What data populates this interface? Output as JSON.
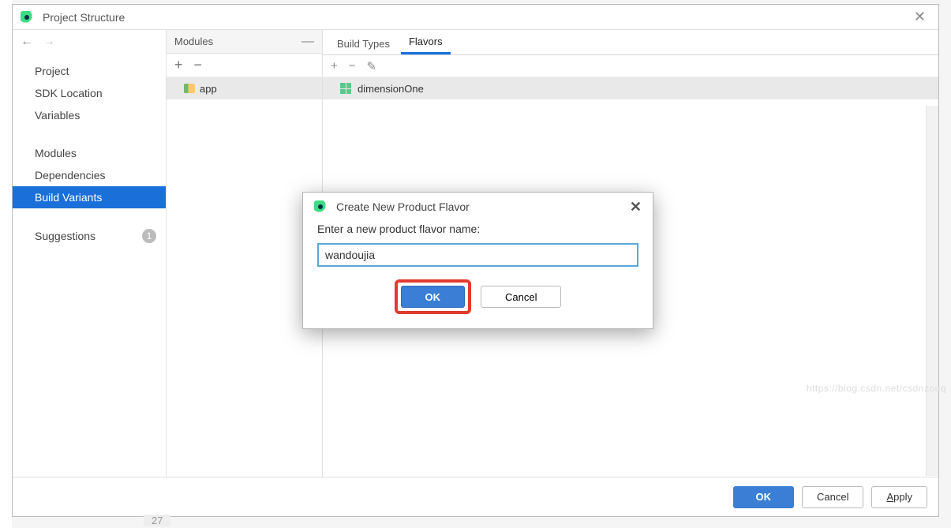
{
  "window": {
    "title": "Project Structure"
  },
  "nav": {
    "back_icon": "←",
    "forward_icon": "→",
    "items": [
      {
        "label": "Project"
      },
      {
        "label": "SDK Location"
      },
      {
        "label": "Variables"
      },
      {
        "label": "Modules"
      },
      {
        "label": "Dependencies"
      },
      {
        "label": "Build Variants",
        "selected": true
      },
      {
        "label": "Suggestions",
        "badge": "1"
      }
    ]
  },
  "modules": {
    "header": "Modules",
    "collapse_icon": "—",
    "add_icon": "+",
    "remove_icon": "−",
    "items": [
      {
        "label": "app"
      }
    ]
  },
  "tabs": {
    "items": [
      {
        "label": "Build Types"
      },
      {
        "label": "Flavors",
        "selected": true
      }
    ]
  },
  "flavors_toolbar": {
    "add_icon": "+",
    "remove_icon": "−",
    "edit_icon": "✎"
  },
  "flavors": {
    "items": [
      {
        "label": "dimensionOne"
      }
    ]
  },
  "bottom": {
    "ok": "OK",
    "cancel": "Cancel",
    "apply_prefix": "A",
    "apply_rest": "pply"
  },
  "modal": {
    "title": "Create New Product Flavor",
    "label": "Enter a new product flavor name:",
    "value": "wandoujia",
    "ok": "OK",
    "cancel": "Cancel"
  },
  "watermark": "https://blog.csdn.net/csdnzouq",
  "code_fragment": {
    "line_no": "27"
  }
}
